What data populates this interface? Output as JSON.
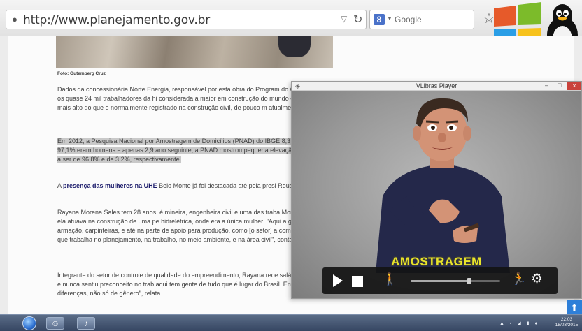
{
  "browser": {
    "url": "http://www.planejamento.gov.br",
    "search_engine": "Google",
    "site_icon": "globe-icon",
    "reload_icon": "reload-icon",
    "bookmark_icon": "star-icon"
  },
  "article": {
    "photo_caption": "Foto: Gutemberg Cruz",
    "paragraph1": "Dados da concessionária Norte Energia, responsável por esta obra do Program do Crescimento (PAC), mostram que entre os quase 24 mil trabalhadores da hi considerada a maior em construção do mundo – as mulheres representam 14,8 bem mais alto do que o normalmente registrado na construção civil, de pouco m atualmente.",
    "paragraph2": "Em 2012, a Pesquisa Nacional por Amostragem de Domicílios (PNAD) do IBGE 8,3 milhões de trabalhadores da construção, 97,1% eram homens e apenas 2,9 ano seguinte, a PNAD mostrou pequena elevação da participação feminina: os passaram a ser de 96,8% e de 3,2%, respectivamente.",
    "paragraph3_prefix": "A ",
    "paragraph3_link": "presença das mulheres na UHE",
    "paragraph3_suffix": " Belo Monte já foi destacada até pela presi Rousseff.",
    "paragraph4": "Rayana Morena Sales tem 28 anos, é mineira, engenheira civil e uma das traba Monte há pouco mais de dois anos. Antes ela atuava na construção de uma pe hidrelétrica, onde era a única mulher. \"Aqui a gente vê mulher desde o campo, armação, carpinteiras, e até na parte de apoio para produção, como [o setor] a comercial. Mas tem muita mulher engenheira que trabalha no planejamento, na trabalho, no meio ambiente, e na área civil\", conta.",
    "paragraph5": "Integrante do setor de controle de qualidade do empreendimento, Rayana rece salário dos homens que ocupam igual posto e nunca sentiu preconceito no trab aqui tem gente de tudo que é lugar do Brasil. Então, o pessoal acaba sendo tol as diferenças, não só de gênero\", relata."
  },
  "player": {
    "title": "VLibras Player",
    "watermark": "AMOSTRAGEM",
    "progress": 0.66,
    "minimize_label": "–",
    "maximize_label": "□",
    "close_label": "×"
  },
  "taskbar": {
    "clock_time": "22:03",
    "clock_date": "18/03/2015",
    "tray_icons": "▲ ▪ ◢ ▮ ●"
  },
  "colors": {
    "watermark": "#e9e42a",
    "close_button": "#c9423b",
    "taskbar": "#364662"
  }
}
